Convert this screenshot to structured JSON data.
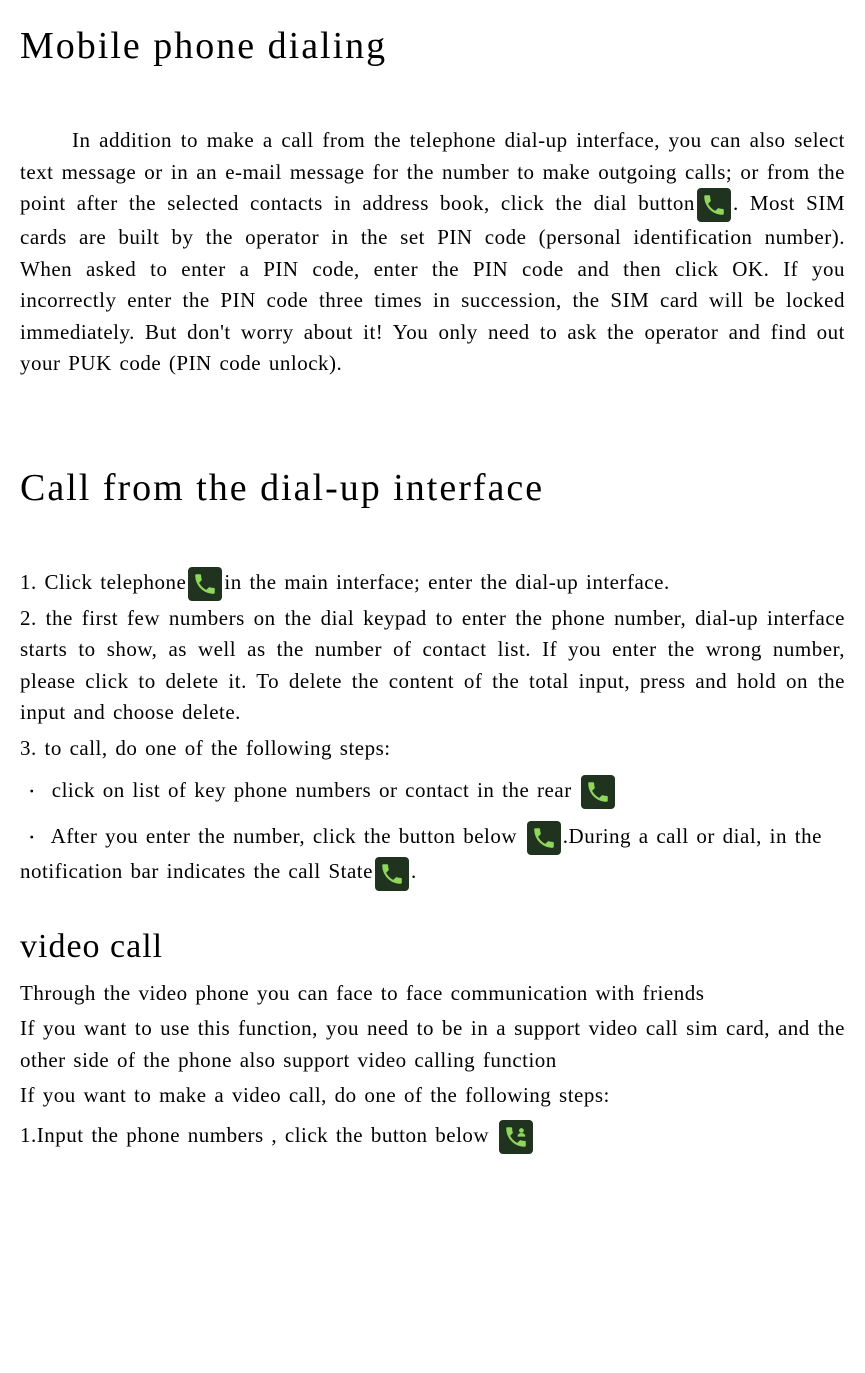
{
  "title": "Mobile phone dialing",
  "para1a": "In addition to make a call from the telephone dial-up interface, you can also select text message or in an e-mail message for the number to make outgoing calls; or from the point after the selected contacts in address book, click the dial button",
  "para1b": ". Most SIM cards are built by the operator in the set PIN code (personal identification number). When asked to enter a PIN code, enter the PIN code and then click OK. If you incorrectly enter the PIN code three times in succession, the SIM card will be locked immediately.  But don't worry about it! You only need to ask the operator and find out your PUK code (PIN code unlock).",
  "h2": "Call from the dial-up interface",
  "step1a": "1. Click telephone",
  "step1b": "in the main interface; enter the dial-up interface.",
  "step2": "2. the first few numbers on the dial keypad to enter the phone number, dial-up interface starts to show, as well as the number of contact list. If you enter the wrong number, please click to delete it. To delete the content of the total input, press and hold on the input and choose delete.",
  "step3": "3. to call, do one of the following steps:",
  "bullet1": "click on list of key phone numbers or contact in the rear ",
  "bullet2a": "After you enter the number, click the button below ",
  "bullet2b": ".During a call or dial, in the notification bar indicates the call State",
  "bullet2c": ".",
  "h3": "video call",
  "vp1": "Through the video phone you can face to face communication with friends",
  "vp2": "If you want to use this function, you need to be in a support video call sim card, and the other side of the phone also support video calling function",
  "vp3": "If you want to make a video call, do one of the following steps:",
  "vstep1a": "1.Input  the phone numbers , click the button below "
}
